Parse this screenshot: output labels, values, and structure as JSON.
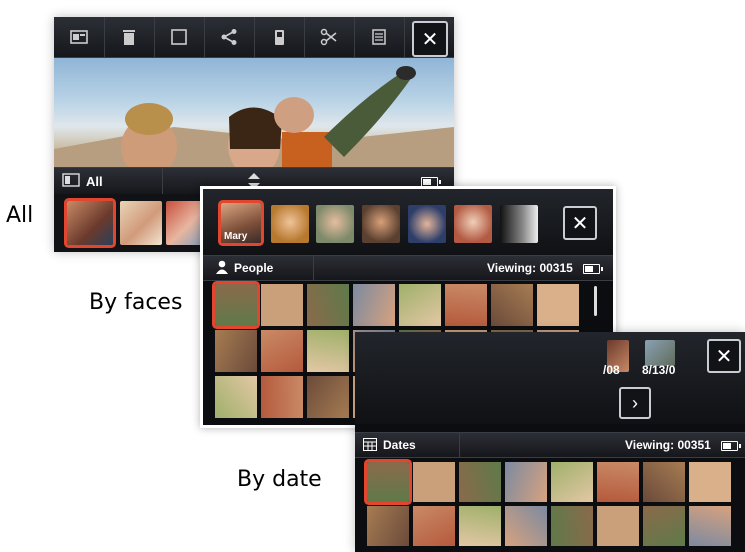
{
  "captions": {
    "all": "All",
    "faces": "By faces",
    "date": "By date"
  },
  "all_view": {
    "filter_label": "All",
    "toolbar_icons": [
      "gallery-icon",
      "trash-icon",
      "square-icon",
      "share-icon",
      "phone-icon",
      "scissors-icon",
      "notes-icon"
    ]
  },
  "faces_view": {
    "face_name": "Mary",
    "filter_label": "People",
    "viewing": "Viewing: 00315"
  },
  "date_view": {
    "date_labels": [
      "/08",
      "8/13/0"
    ],
    "filter_label": "Dates",
    "viewing": "Viewing: 00351"
  },
  "colors": {
    "selection": "#e2462f",
    "panel": "#0c0d10",
    "bar": "#24272d"
  }
}
